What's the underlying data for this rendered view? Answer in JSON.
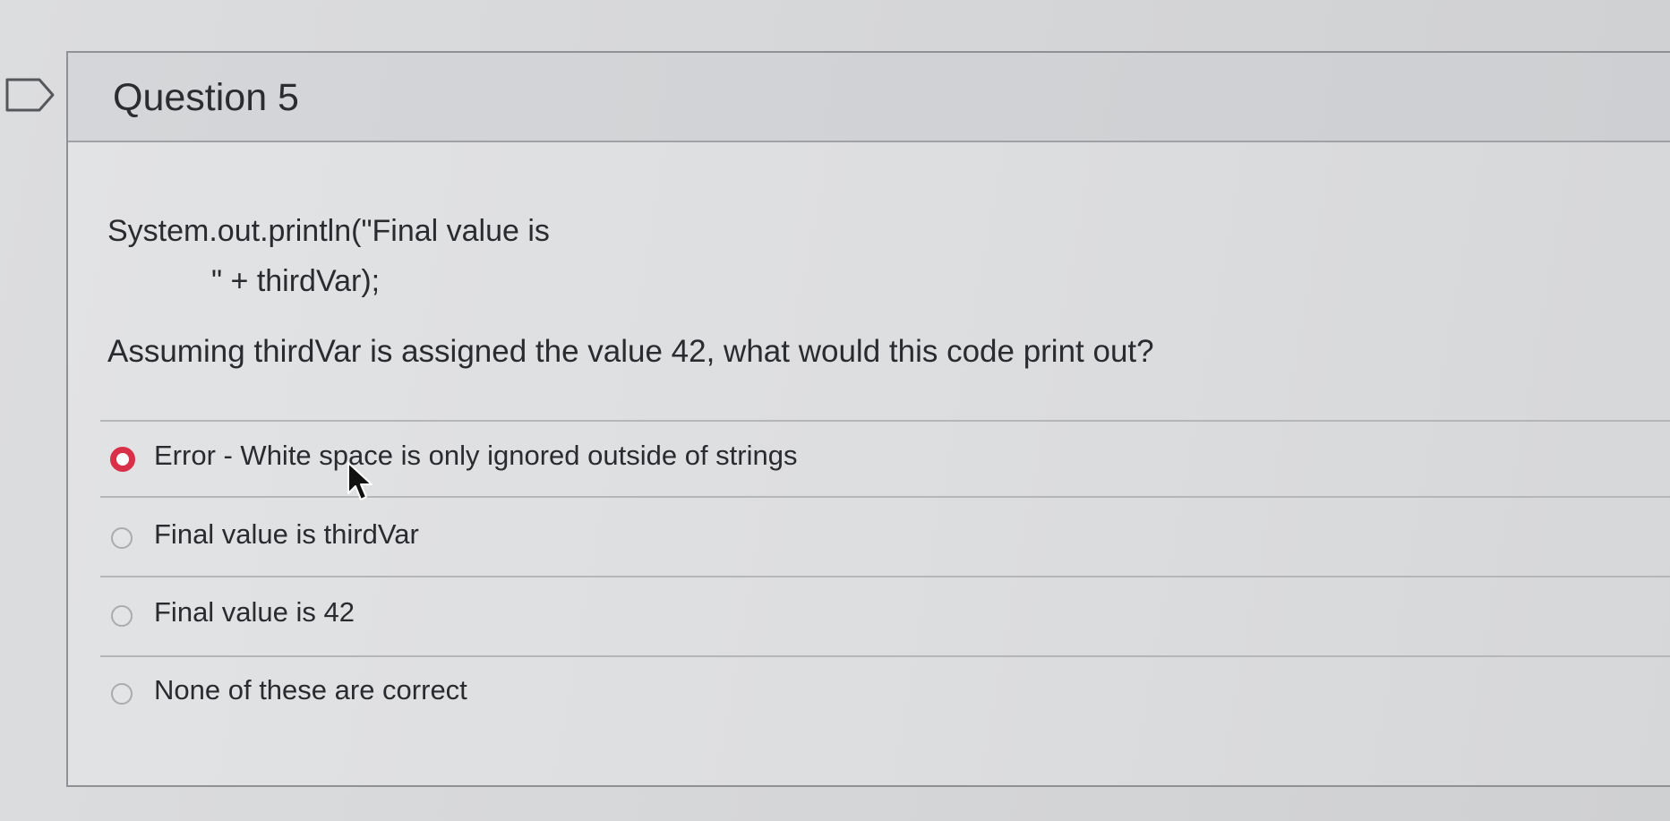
{
  "question": {
    "title": "Question 5",
    "code_line_1": "System.out.println(\"Final value is",
    "code_line_2": "\" + thirdVar);",
    "prompt": "Assuming thirdVar is assigned the value 42, what would this code print out?"
  },
  "answers": [
    {
      "label": "Error - White space is only ignored outside of strings",
      "selected": true
    },
    {
      "label": "Final value is thirdVar",
      "selected": false
    },
    {
      "label": "Final value is 42",
      "selected": false
    },
    {
      "label": "None of these are correct",
      "selected": false
    }
  ],
  "colors": {
    "selected_radio": "#d9304a",
    "background": "#d6d7d9"
  },
  "icons": {
    "flag": "flag-question-icon",
    "cursor": "mouse-pointer-icon"
  }
}
